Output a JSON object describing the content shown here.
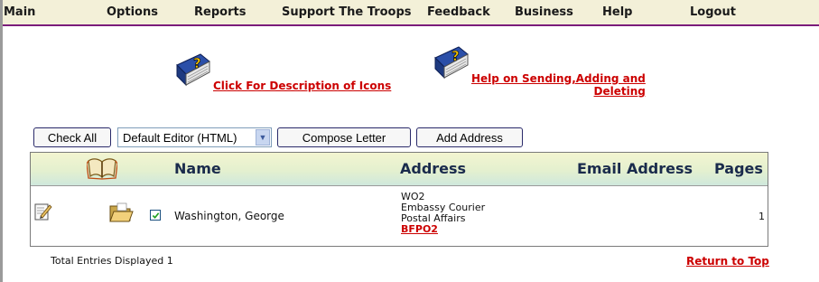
{
  "nav": {
    "items": [
      "Main",
      "Options",
      "Reports",
      "Support The Troops",
      "Feedback",
      "Business",
      "Help",
      "Logout"
    ]
  },
  "help_links": {
    "icons_label": "Click For Description of Icons",
    "sending_label_line1": "Help on Sending,Adding and",
    "sending_label_line2": "Deleting"
  },
  "toolbar": {
    "check_all": "Check All",
    "editor_selected": "Default Editor (HTML)",
    "compose": "Compose Letter",
    "add_address": "Add Address"
  },
  "table": {
    "columns": {
      "name": "Name",
      "address": "Address",
      "email": "Email Address",
      "pages": "Pages"
    },
    "rows": [
      {
        "checked": true,
        "name": "Washington, George",
        "address_lines": [
          "WO2",
          "Embassy Courier",
          "Postal Affairs"
        ],
        "address_link": "BFPO2",
        "email": "",
        "pages": "1"
      }
    ]
  },
  "footer": {
    "total": "Total Entries Displayed 1",
    "return_top": "Return to Top"
  },
  "colors": {
    "link_red": "#cc0000",
    "nav_bg": "#f3f0d8",
    "nav_border": "#7b1c7b"
  }
}
